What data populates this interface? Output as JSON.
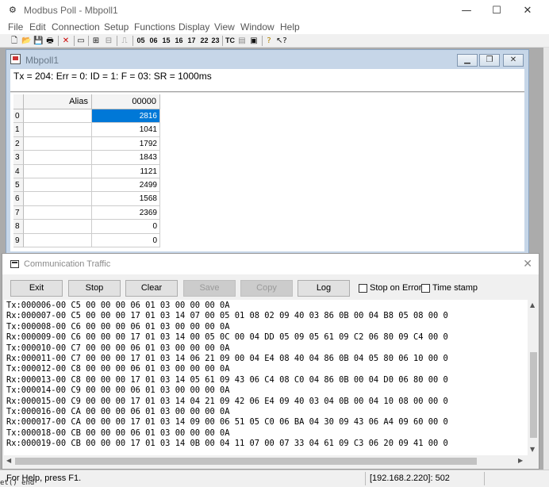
{
  "app": {
    "title": "Modbus Poll - Mbpoll1",
    "window_controls": {
      "minimize": "—",
      "maximize": "☐",
      "close": "✕"
    }
  },
  "menu": [
    "File",
    "Edit",
    "Connection",
    "Setup",
    "Functions",
    "Display",
    "View",
    "Window",
    "Help"
  ],
  "toolbar": {
    "function_codes": [
      "05",
      "06",
      "15",
      "16",
      "17",
      "22",
      "23"
    ],
    "tc_label": "TC"
  },
  "mbpoll": {
    "title": "Mbpoll1",
    "status_line": "Tx = 204: Err = 0: ID = 1: F = 03: SR = 1000ms",
    "header": {
      "alias": "Alias",
      "address": "00000"
    },
    "rows": [
      {
        "idx": "0",
        "value": "2816",
        "selected": true
      },
      {
        "idx": "1",
        "value": "1041"
      },
      {
        "idx": "2",
        "value": "1792"
      },
      {
        "idx": "3",
        "value": "1843"
      },
      {
        "idx": "4",
        "value": "1121"
      },
      {
        "idx": "5",
        "value": "2499"
      },
      {
        "idx": "6",
        "value": "1568"
      },
      {
        "idx": "7",
        "value": "2369"
      },
      {
        "idx": "8",
        "value": "0"
      },
      {
        "idx": "9",
        "value": "0"
      }
    ]
  },
  "traffic": {
    "title": "Communication Traffic",
    "buttons": {
      "exit": "Exit",
      "stop": "Stop",
      "clear": "Clear",
      "save": "Save",
      "copy": "Copy",
      "log": "Log"
    },
    "checkboxes": {
      "stop_on_error": "Stop on Error",
      "time_stamp": "Time stamp"
    },
    "lines": [
      "Tx:000006-00 C5 00 00 00 06 01 03 00 00 00 0A",
      "Rx:000007-00 C5 00 00 00 17 01 03 14 07 00 05 01 08 02 09 40 03 86 0B 00 04 B8 05 08 00 0",
      "Tx:000008-00 C6 00 00 00 06 01 03 00 00 00 0A",
      "Rx:000009-00 C6 00 00 00 17 01 03 14 00 05 0C 00 04 DD 05 09 05 61 09 C2 06 80 09 C4 00 0",
      "Tx:000010-00 C7 00 00 00 06 01 03 00 00 00 0A",
      "Rx:000011-00 C7 00 00 00 17 01 03 14 06 21 09 00 04 E4 08 40 04 86 0B 04 05 80 06 10 00 0",
      "Tx:000012-00 C8 00 00 00 06 01 03 00 00 00 0A",
      "Rx:000013-00 C8 00 00 00 17 01 03 14 05 61 09 43 06 C4 08 C0 04 86 0B 00 04 D0 06 80 00 0",
      "Tx:000014-00 C9 00 00 00 06 01 03 00 00 00 0A",
      "Rx:000015-00 C9 00 00 00 17 01 03 14 04 21 09 42 06 E4 09 40 03 04 0B 00 04 10 08 00 00 0",
      "Tx:000016-00 CA 00 00 00 06 01 03 00 00 00 0A",
      "Rx:000017-00 CA 00 00 00 17 01 03 14 09 00 06 51 05 C0 06 BA 04 30 09 43 06 A4 09 60 00 0",
      "Tx:000018-00 CB 00 00 00 06 01 03 00 00 00 0A",
      "Rx:000019-00 CB 00 00 00 17 01 03 14 0B 00 04 11 07 00 07 33 04 61 09 C3 06 20 09 41 00 0"
    ]
  },
  "statusbar": {
    "help": "For Help, press F1.",
    "connection": "[192.168.2.220]: 502"
  },
  "edge_text": "et() end"
}
